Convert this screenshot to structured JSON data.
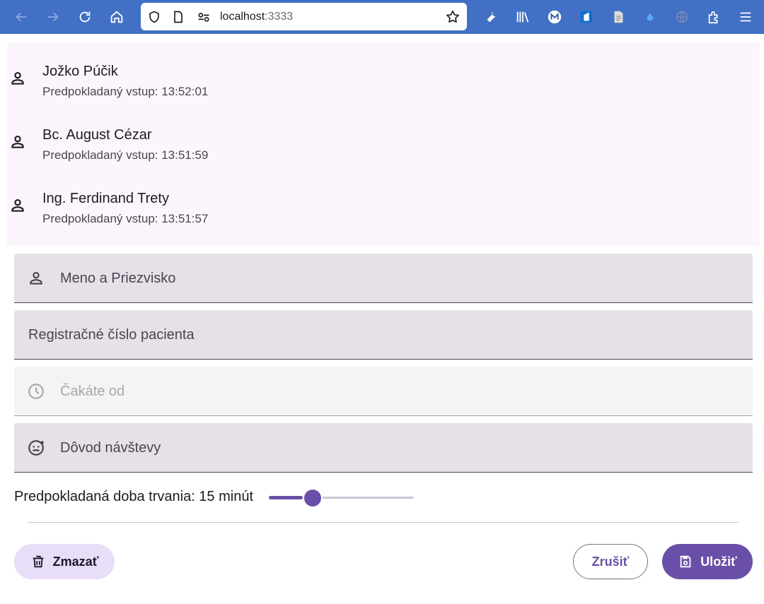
{
  "browser": {
    "url_host": "localhost",
    "url_port": ":3333"
  },
  "patients": [
    {
      "name": "Jožko Púčik",
      "subtitle": "Predpokladaný vstup: 13:52:01"
    },
    {
      "name": "Bc. August Cézar",
      "subtitle": "Predpokladaný vstup: 13:51:59"
    },
    {
      "name": "Ing. Ferdinand Trety",
      "subtitle": "Predpokladaný vstup: 13:51:57"
    }
  ],
  "form": {
    "name_label": "Meno a Priezvisko",
    "reg_label": "Registračné číslo pacienta",
    "waiting_label": "Čakáte od",
    "reason_label": "Dôvod návštevy",
    "duration_label": "Predpokladaná doba trvania: 15 minút",
    "duration_slider_fraction": 0.3
  },
  "buttons": {
    "delete": "Zmazať",
    "cancel": "Zrušiť",
    "save": "Uložiť"
  },
  "colors": {
    "toolbar": "#4170c4",
    "primary": "#6a4fa8",
    "list_bg": "#fdf5fe",
    "field_bg": "#e6e0e9"
  }
}
